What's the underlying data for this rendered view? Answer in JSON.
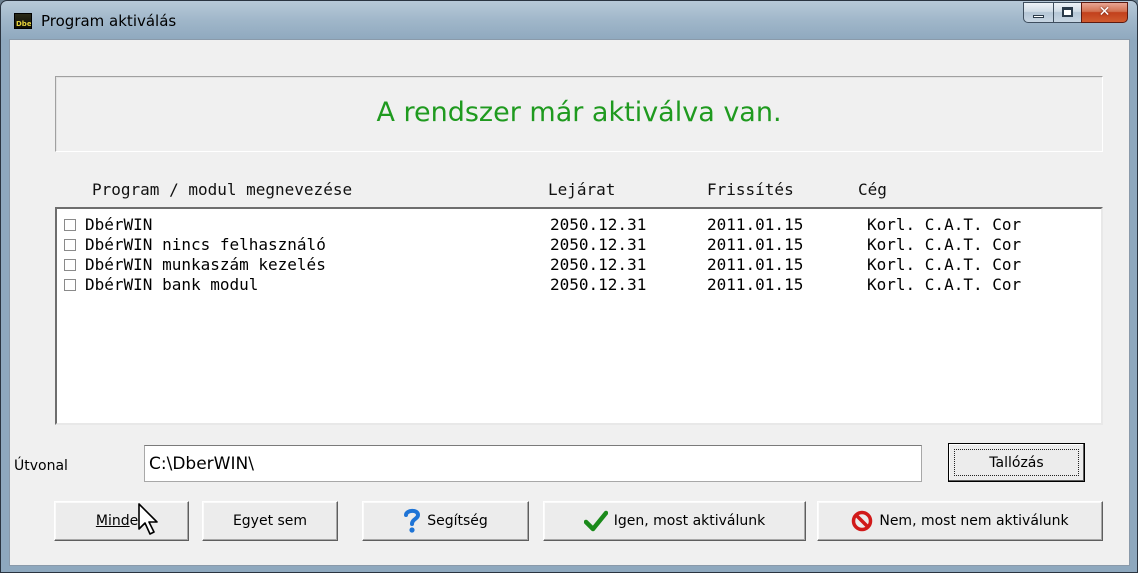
{
  "window": {
    "title": "Program aktiválás",
    "icon_text": "Dber"
  },
  "status": {
    "message": "A rendszer már aktiválva van.",
    "color": "#1f9a1f"
  },
  "columns": {
    "name": "Program / modul megnevezése",
    "expiry": "Lejárat",
    "update": "Frissítés",
    "company": "Cég"
  },
  "rows": [
    {
      "name": "DbérWIN",
      "expiry": "2050.12.31",
      "update": "2011.01.15",
      "company": "Korl. C.A.T. Cor",
      "checked": false
    },
    {
      "name": "DbérWIN nincs felhasználó",
      "expiry": "2050.12.31",
      "update": "2011.01.15",
      "company": "Korl. C.A.T. Cor",
      "checked": false
    },
    {
      "name": "DbérWIN munkaszám kezelés",
      "expiry": "2050.12.31",
      "update": "2011.01.15",
      "company": "Korl. C.A.T. Cor",
      "checked": false
    },
    {
      "name": "DbérWIN bank modul",
      "expiry": "2050.12.31",
      "update": "2011.01.15",
      "company": "Korl. C.A.T. Cor",
      "checked": false
    }
  ],
  "path": {
    "label": "Útvonal",
    "value": "C:\\DberWIN\\"
  },
  "buttons": {
    "browse": "Tallózás",
    "all": "Mind",
    "all_rest": "en",
    "none": "Egyet sem",
    "help": "Segítség",
    "activate": "Igen, most aktiválunk",
    "dont_activate": "Nem, most nem aktiválunk"
  },
  "icons": {
    "help": "question-icon",
    "activate": "checkmark-icon",
    "dont_activate": "no-entry-icon"
  }
}
